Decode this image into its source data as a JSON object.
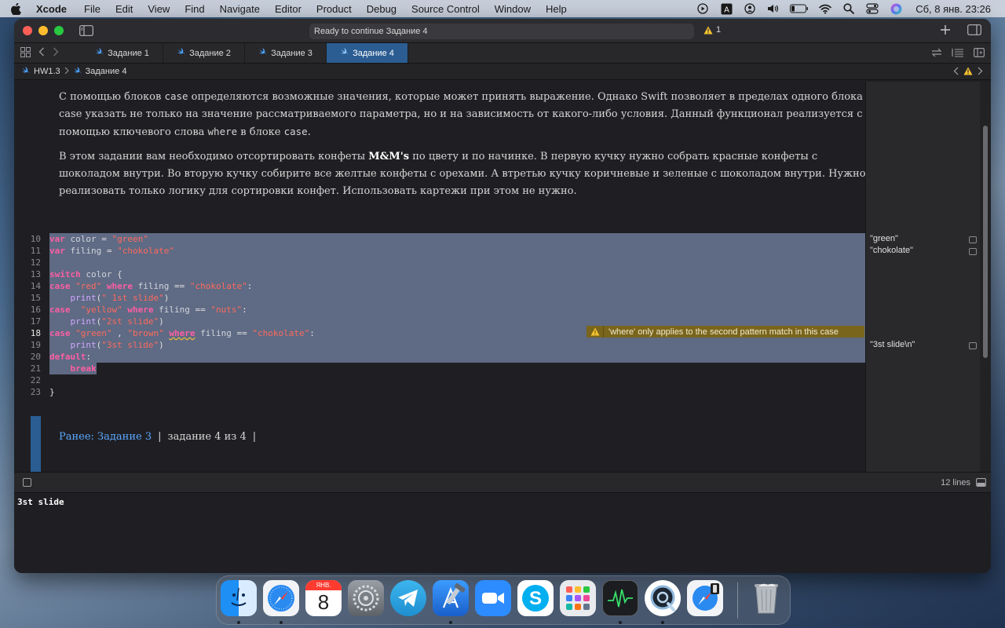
{
  "menubar": {
    "app_name": "Xcode",
    "items": [
      "File",
      "Edit",
      "View",
      "Find",
      "Navigate",
      "Editor",
      "Product",
      "Debug",
      "Source Control",
      "Window",
      "Help"
    ],
    "clock": "Сб, 8 янв.  23:26"
  },
  "window": {
    "activity_status": "Ready to continue Задание 4",
    "warning_count": "1"
  },
  "tabs": [
    {
      "label": "Задание 1"
    },
    {
      "label": "Задание 2"
    },
    {
      "label": "Задание 3"
    },
    {
      "label": "Задание 4"
    }
  ],
  "jumpbar": {
    "project": "HW1.3",
    "page": "Задание 4"
  },
  "prose": {
    "p1_a": "С помощью блоков ",
    "p1_code1": "case",
    "p1_b": " определяются возможные значения, которые может принять выражение. Однако Swift позволяет в пределах одного блока case указать не только на значение рассматриваемого параметра, но и на зависимость от какого-либо условия. Данный функционал реализуется с помощью ключевого слова ",
    "p1_code2": "where",
    "p1_c": " в блоке ",
    "p1_code3": "case",
    "p1_d": ".",
    "p2_a": "В этом задании вам необходимо отсортировать конфеты ",
    "p2_bold": "M&M's",
    "p2_b": " по цвету и по начинке. В первую кучку нужно собрать красные конфеты с шоколадом внутри. Во вторую кучку собирите все желтые конфеты с орехами. А втретью кучку коричневые и зеленые с шоколадом внутри. Нужно реализовать только логику для сортировки конфет. Использовать картежи при этом не нужно."
  },
  "code": {
    "line_numbers": [
      "10",
      "11",
      "12",
      "13",
      "14",
      "15",
      "16",
      "17",
      "18",
      "19",
      "20",
      "21",
      "22",
      "23"
    ],
    "l10_kw": "var",
    "l10_id": "color",
    "l10_op": " = ",
    "l10_str": "\"green\"",
    "l11_kw": "var",
    "l11_id": "filing",
    "l11_op": " = ",
    "l11_str": "\"chokolate\"",
    "l13_kw": "switch",
    "l13_id": "color",
    "l13_br": " {",
    "l14_kw": "case",
    "l14_str1": "\"red\"",
    "l14_kw2": "where",
    "l14_id": "filing",
    "l14_op": " == ",
    "l14_str2": "\"chokolate\"",
    "l14_colon": ":",
    "l15_fn": "print",
    "l15_str": "\" 1st slide\"",
    "l16_kw": "case",
    "l16_str1": "\"yellow\"",
    "l16_kw2": "where",
    "l16_id": "filing",
    "l16_op": " == ",
    "l16_str2": "\"nuts\"",
    "l16_colon": ":",
    "l17_fn": "print",
    "l17_str": "\"2st slide\"",
    "l18_kw": "case",
    "l18_str1": "\"green\"",
    "l18_comma": " , ",
    "l18_str2": "\"brown\"",
    "l18_kw2": "where",
    "l18_id": "filing",
    "l18_op": " == ",
    "l18_str3": "\"chokolate\"",
    "l18_colon": ":",
    "l19_fn": "print",
    "l19_str": "\"3st slide\"",
    "l20_kw": "default",
    "l20_colon": ":",
    "l21_kw": "break",
    "l23_br": "}"
  },
  "issue": {
    "message": "'where' only applies to the second pattern match in this case"
  },
  "results": {
    "r10": "\"green\"",
    "r11": "\"chokolate\"",
    "r19": "\"3st slide\\n\""
  },
  "footer_nav": {
    "previous": "Ранее: Задание 3",
    "position": "задание 4 из 4"
  },
  "debug": {
    "line_count": "12 lines",
    "console_output": "3st slide"
  },
  "dock": {
    "calendar_month": "ЯНВ.",
    "calendar_day": "8"
  },
  "colors": {
    "accent": "#2b5d93",
    "selection": "#5f6a84",
    "warning_bg": "#79651c",
    "keyword": "#fc5fa3",
    "string": "#fc6a5d"
  }
}
